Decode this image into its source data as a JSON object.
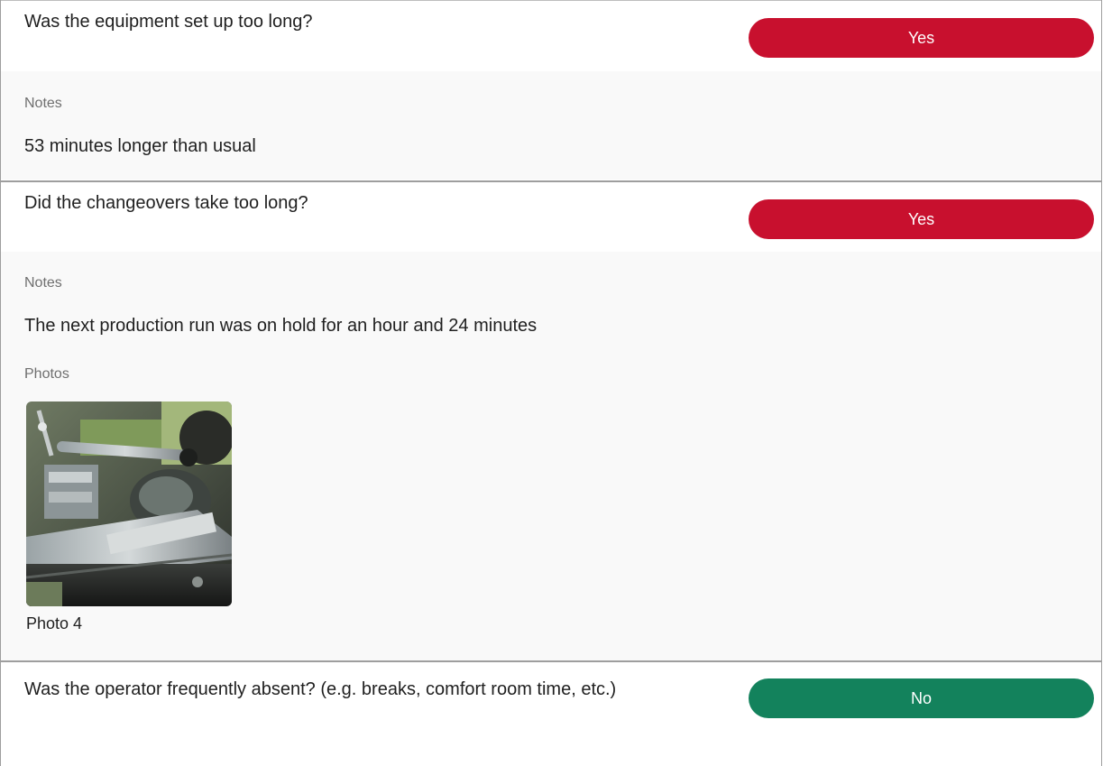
{
  "items": [
    {
      "question": "Was the equipment set up too long?",
      "answer": "Yes",
      "notes_label": "Notes",
      "notes": "53 minutes longer than usual"
    },
    {
      "question": "Did the changeovers take too long?",
      "answer": "Yes",
      "notes_label": "Notes",
      "notes": "The next production run was on hold for an hour and 24 minutes",
      "photos_label": "Photos",
      "photos": [
        {
          "caption": "Photo 4"
        }
      ]
    },
    {
      "question": "Was the operator frequently absent? (e.g. breaks, comfort room time, etc.)",
      "answer": "No"
    }
  ],
  "colors": {
    "yes": "#c8102e",
    "no": "#13825c",
    "details_background": "#f9f9f9",
    "border": "#9e9e9e"
  }
}
